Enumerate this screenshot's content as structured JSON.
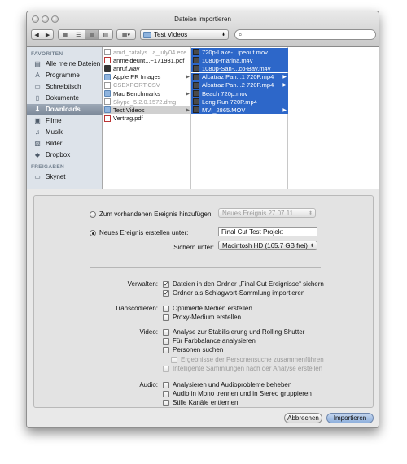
{
  "window": {
    "title": "Dateien importieren"
  },
  "toolbar": {
    "folder": "Test Videos",
    "search_placeholder": ""
  },
  "sidebar": {
    "favorites_header": "FAVORITEN",
    "shared_header": "FREIGABEN",
    "favorites": [
      {
        "label": "Alle meine Dateien",
        "icon": "all-files-icon"
      },
      {
        "label": "Programme",
        "icon": "applications-icon"
      },
      {
        "label": "Schreibtisch",
        "icon": "desktop-icon"
      },
      {
        "label": "Dokumente",
        "icon": "documents-icon"
      },
      {
        "label": "Downloads",
        "icon": "downloads-icon",
        "selected": true
      },
      {
        "label": "Filme",
        "icon": "movies-icon"
      },
      {
        "label": "Musik",
        "icon": "music-icon"
      },
      {
        "label": "Bilder",
        "icon": "pictures-icon"
      },
      {
        "label": "Dropbox",
        "icon": "dropbox-icon"
      }
    ],
    "shared": [
      {
        "label": "Skynet",
        "icon": "network-computer-icon"
      }
    ]
  },
  "columns": {
    "downloads": [
      {
        "name": "amd_catalys...a_july04.exe",
        "kind": "doc",
        "dim": true
      },
      {
        "name": "anmeldeunt...~171931.pdf",
        "kind": "pdf"
      },
      {
        "name": "anruf.wav",
        "kind": "audio"
      },
      {
        "name": "Apple PR Images",
        "kind": "folder",
        "arrow": true
      },
      {
        "name": "CSEXPORT.CSV",
        "kind": "doc",
        "dim": true
      },
      {
        "name": "Mac Benchmarks",
        "kind": "folder",
        "arrow": true
      },
      {
        "name": "Skype_5.2.0.1572.dmg",
        "kind": "doc",
        "dim": true
      },
      {
        "name": "Test Videos",
        "kind": "folder",
        "arrow": true,
        "selected": true
      },
      {
        "name": "Vertrag.pdf",
        "kind": "pdf"
      }
    ],
    "test_videos": [
      {
        "name": "720p-Lake-...ipeout.mov",
        "kind": "movie"
      },
      {
        "name": "1080p-marina.m4v",
        "kind": "movie"
      },
      {
        "name": "1080p-San-...co-Bay.m4v",
        "kind": "movie"
      },
      {
        "name": "Alcatraz Pan...1 720P.mp4",
        "kind": "movie",
        "arrow": true
      },
      {
        "name": "Alcatraz Pan...2 720P.mp4",
        "kind": "movie",
        "arrow": true
      },
      {
        "name": "Beach 720p.mov",
        "kind": "movie"
      },
      {
        "name": "Long Run 720P.mp4",
        "kind": "movie"
      },
      {
        "name": "MVI_2865.MOV",
        "kind": "movie",
        "arrow": true
      }
    ]
  },
  "options": {
    "add_existing_label": "Zum vorhandenen Ereignis hinzufügen:",
    "add_existing_value": "Neues Ereignis 27.07.11",
    "create_new_label": "Neues Ereignis erstellen unter:",
    "event_name": "Final Cut Test Projekt",
    "save_to_label": "Sichern unter:",
    "save_to_value": "Macintosh HD  (165.7 GB frei)",
    "manage": {
      "label": "Verwalten:",
      "items": [
        {
          "label": "Dateien in den Ordner „Final Cut Ereignisse“ sichern",
          "checked": true
        },
        {
          "label": "Ordner als Schlagwort-Sammlung importieren",
          "checked": true
        }
      ]
    },
    "transcode": {
      "label": "Transcodieren:",
      "items": [
        {
          "label": "Optimierte Medien erstellen",
          "checked": false
        },
        {
          "label": "Proxy-Medium erstellen",
          "checked": false
        }
      ]
    },
    "video": {
      "label": "Video:",
      "items": [
        {
          "label": "Analyse zur Stabilisierung und Rolling Shutter",
          "checked": false
        },
        {
          "label": "Für Farbbalance analysieren",
          "checked": false
        },
        {
          "label": "Personen suchen",
          "checked": false
        },
        {
          "label": "Ergebnisse der Personensuche zusammenführen",
          "checked": false,
          "disabled": true
        },
        {
          "label": "Intelligente Sammlungen nach der Analyse erstellen",
          "checked": false,
          "disabled": true
        }
      ]
    },
    "audio": {
      "label": "Audio:",
      "items": [
        {
          "label": "Analysieren und Audioprobleme beheben",
          "checked": false
        },
        {
          "label": "Audio in Mono trennen und in Stereo gruppieren",
          "checked": false
        },
        {
          "label": "Stille Kanäle entfernen",
          "checked": false
        }
      ]
    }
  },
  "buttons": {
    "cancel": "Abbrechen",
    "import": "Importieren"
  }
}
